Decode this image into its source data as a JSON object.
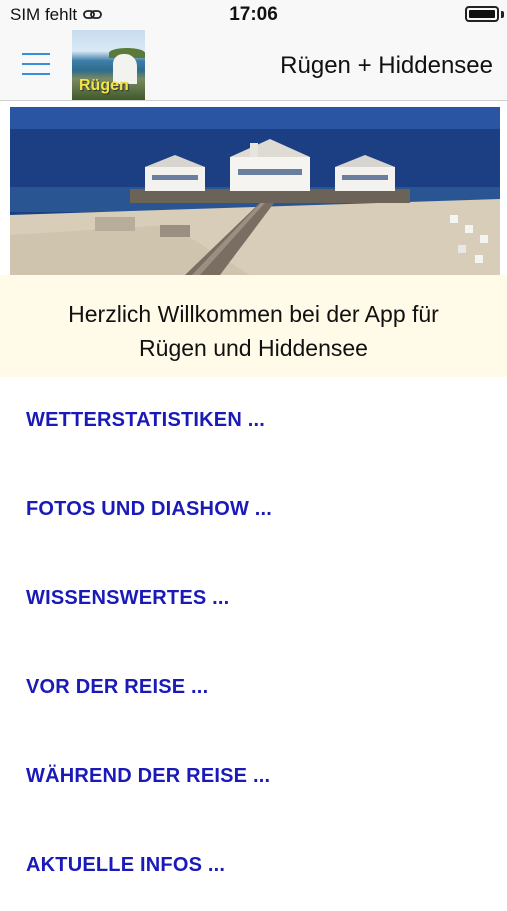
{
  "status_bar": {
    "carrier": "SIM fehlt",
    "link_icon": "link-icon",
    "time": "17:06",
    "battery_icon": "battery-icon"
  },
  "nav": {
    "menu_icon": "hamburger-icon",
    "logo_text": "Rügen",
    "title": "Rügen + Hiddensee"
  },
  "welcome": {
    "line1": "Herzlich Willkommen bei der App für",
    "line2": "Rügen und Hiddensee"
  },
  "menu": {
    "items": [
      {
        "label": "WETTERSTATISTIKEN ..."
      },
      {
        "label": "FOTOS UND DIASHOW ..."
      },
      {
        "label": "WISSENSWERTES ..."
      },
      {
        "label": "VOR DER REISE ..."
      },
      {
        "label": "WÄHREND DER REISE ..."
      },
      {
        "label": "AKTUELLE INFOS ..."
      }
    ]
  },
  "colors": {
    "menu_text": "#1a1ab8",
    "accent": "#3a8fd6",
    "welcome_bg": "#fffbe8"
  }
}
